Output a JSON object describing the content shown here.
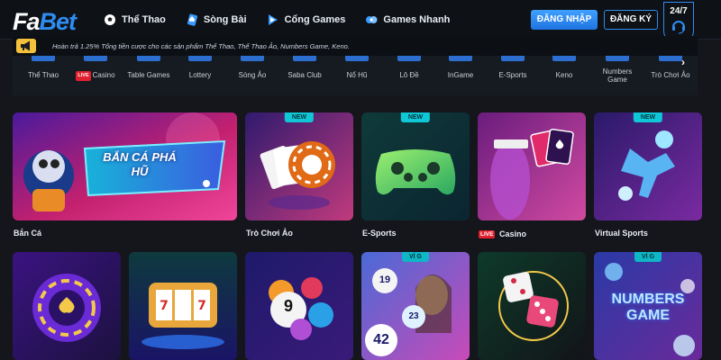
{
  "header": {
    "logo_left": "Fa",
    "logo_right": "Bet",
    "nav": [
      {
        "label": "Thể Thao",
        "icon": "soccer-ball-icon"
      },
      {
        "label": "Sòng Bài",
        "icon": "spade-card-icon"
      },
      {
        "label": "Cổng Games",
        "icon": "game-portal-icon"
      },
      {
        "label": "Games Nhanh",
        "icon": "quick-game-icon"
      }
    ],
    "login_label": "ĐĂNG NHẬP",
    "register_label": "ĐĂNG KÝ",
    "support_label": "24/7"
  },
  "announcement": {
    "text": "Hoàn trả 1.25% Tổng tiền cược cho các sản phẩm Thể Thao, Thể Thao Ảo, Numbers Game, Keno."
  },
  "categories": [
    {
      "label": "Thể Thao"
    },
    {
      "label": "Casino",
      "badge": "LIVE"
    },
    {
      "label": "Table Games"
    },
    {
      "label": "Lottery"
    },
    {
      "label": "Sòng Ảo"
    },
    {
      "label": "Saba Club"
    },
    {
      "label": "Nổ Hũ"
    },
    {
      "label": "Lô Đề"
    },
    {
      "label": "InGame"
    },
    {
      "label": "E-Sports"
    },
    {
      "label": "Keno"
    },
    {
      "label": "Numbers Game"
    },
    {
      "label": "Trò Chơi Ảo"
    }
  ],
  "row1": [
    {
      "caption": "Bắn Cá",
      "art_text": "BẮN CÁ PHÁ HŨ"
    },
    {
      "caption": "Trò Chơi Ảo",
      "tag": "NEW"
    },
    {
      "caption": "E-Sports",
      "tag": "NEW"
    },
    {
      "caption": "Casino",
      "badge": "LIVE"
    },
    {
      "caption": "Virtual Sports",
      "tag": "NEW"
    }
  ],
  "row2": [
    {},
    {},
    {
      "ball_number": "9"
    },
    {
      "tag": "VÍ G",
      "balls": [
        "19",
        "23",
        "42"
      ]
    },
    {},
    {
      "tag": "VÍ G",
      "art_text_1": "NUMBERS",
      "art_text_2": "GAME"
    }
  ],
  "colors": {
    "accent": "#2f8cf0",
    "background": "#14161c",
    "new_tag": "#0fc7d6",
    "live": "#e0202e"
  }
}
